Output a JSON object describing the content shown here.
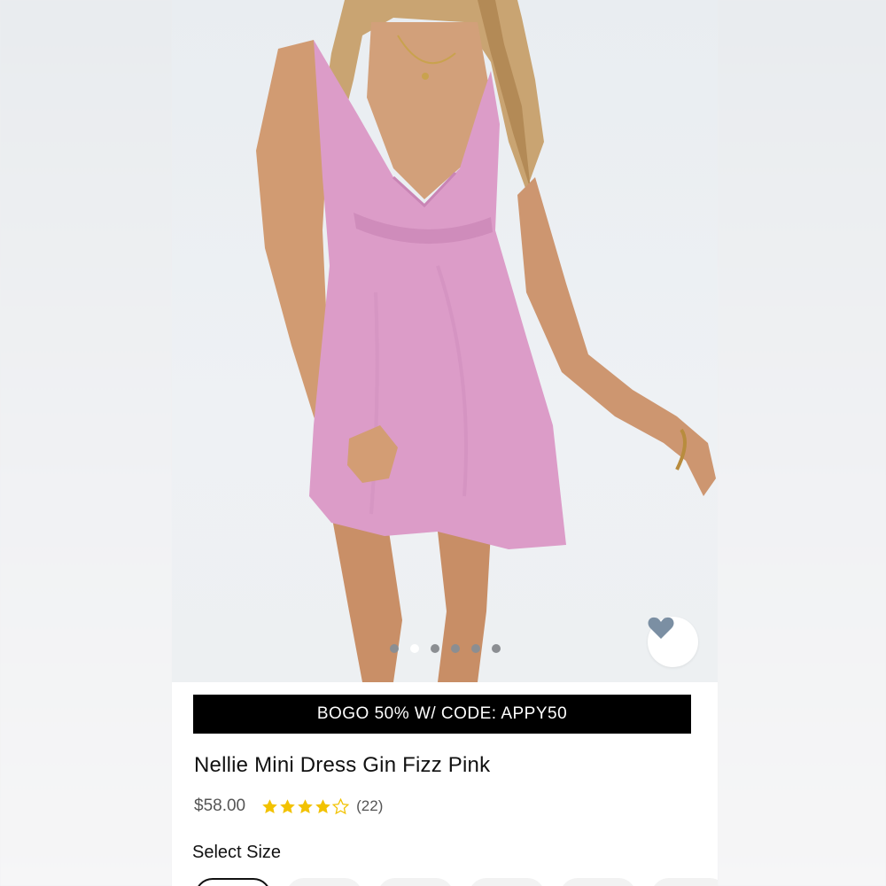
{
  "promo": {
    "banner_text": "BOGO 50% W/ CODE: APPY50"
  },
  "product": {
    "title": "Nellie Mini Dress Gin Fizz Pink",
    "price": "$58.00",
    "rating": 4.5,
    "rating_max": 5,
    "review_count": "(22)",
    "color": "#dc9cc8"
  },
  "gallery": {
    "image_count": 6,
    "active_index": 1,
    "favorite_icon": "heart-icon"
  },
  "sizes": {
    "label": "Select Size",
    "options_visible": 6,
    "selected_index": 0
  },
  "colors": {
    "banner_bg": "#000000",
    "star": "#f2c200",
    "heart": "#7b8fa3"
  }
}
